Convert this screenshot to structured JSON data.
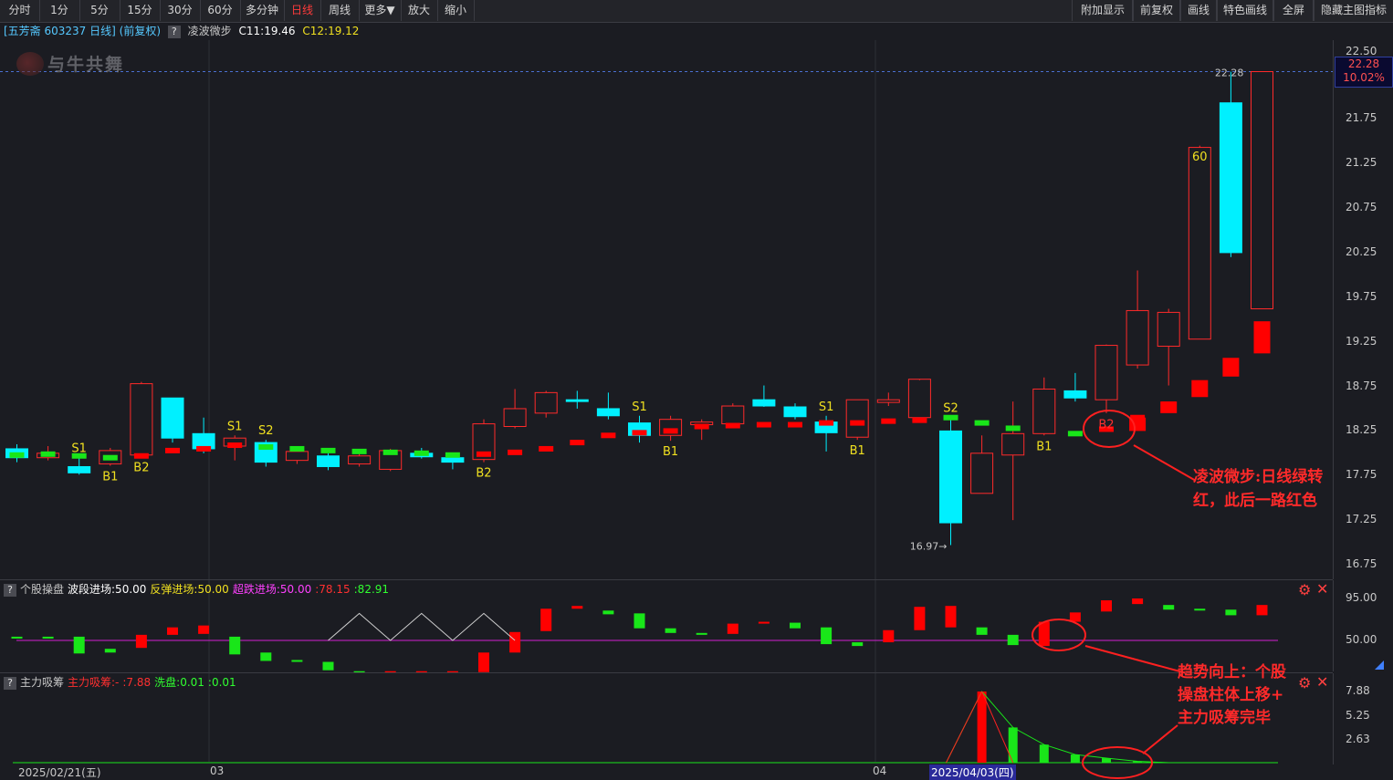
{
  "toolbar": {
    "left": [
      "分时",
      "1分",
      "5分",
      "15分",
      "30分",
      "60分",
      "多分钟",
      "日线",
      "周线",
      "更多▼",
      "放大",
      "缩小"
    ],
    "active": "日线",
    "right": [
      "附加显示",
      "前复权",
      "画线",
      "特色画线",
      "全屏",
      "隐藏主图指标"
    ]
  },
  "info": {
    "stock": "[五芳斋 603237 日线]",
    "adjust": "(前复权)",
    "q": "?",
    "indicator": "凌波微步",
    "c1": "C11:19.46",
    "c2": "C12:19.12"
  },
  "watermark": "与牛共舞",
  "main_axis": [
    "22.50",
    "21.75",
    "21.25",
    "20.75",
    "20.25",
    "19.75",
    "19.25",
    "18.75",
    "18.25",
    "17.75",
    "17.25",
    "16.75"
  ],
  "price_tag": {
    "price": "22.28",
    "pct": "10.02%"
  },
  "high_label": "22.28",
  "low_label": "16.97→",
  "signal_labels": {
    "b1": "B1",
    "b2": "B2",
    "s1": "S1",
    "s2": "S2",
    "sixty": "60"
  },
  "ind1": {
    "q": "?",
    "name": "个股操盘",
    "wave": "波段进场:50.00",
    "rebound": "反弹进场:50.00",
    "oversold": "超跌进场:50.00",
    "v1": ":78.15",
    "v2": ":82.91",
    "axis": [
      "95.00",
      "50.00"
    ]
  },
  "ind2": {
    "q": "?",
    "name": "主力吸筹",
    "absorb": "主力吸筹:-",
    "absorb_val": ":7.88",
    "wash": "洗盘:0.01",
    "v": ":0.01",
    "axis": [
      "7.88",
      "5.25",
      "2.63"
    ]
  },
  "dates": {
    "d1": "2025/02/21(五)",
    "d2": "03",
    "d3": "04",
    "d4": "2025/04/03(四)"
  },
  "annotations": {
    "a1_line1": "凌波微步:日线绿转",
    "a1_line2": "红，此后一路红色",
    "a2_line1": "趋势向上：个股",
    "a2_line2": "操盘柱体上移+",
    "a2_line3": "主力吸筹完毕"
  },
  "colors": {
    "up": "#ff2a2a",
    "down": "#00f0ff",
    "signal_green": "#19e619",
    "signal_red": "#ff0000",
    "ma_line": "#d020d0",
    "label_yellow": "#f0e020"
  },
  "chart_data": {
    "type": "candlestick",
    "ylim": [
      16.75,
      22.5
    ],
    "candles": [
      {
        "o": 18.05,
        "h": 18.1,
        "l": 17.9,
        "c": 17.95
      },
      {
        "o": 17.95,
        "h": 18.08,
        "l": 17.92,
        "c": 18.0
      },
      {
        "o": 17.85,
        "h": 17.95,
        "l": 17.76,
        "c": 17.78
      },
      {
        "o": 17.88,
        "h": 18.06,
        "l": 17.86,
        "c": 18.03
      },
      {
        "o": 17.98,
        "h": 18.8,
        "l": 17.96,
        "c": 18.78
      },
      {
        "o": 18.62,
        "h": 18.62,
        "l": 18.12,
        "c": 18.17
      },
      {
        "o": 18.22,
        "h": 18.4,
        "l": 18.0,
        "c": 18.05
      },
      {
        "o": 18.08,
        "h": 18.2,
        "l": 17.92,
        "c": 18.17
      },
      {
        "o": 18.12,
        "h": 18.15,
        "l": 17.85,
        "c": 17.9
      },
      {
        "o": 17.92,
        "h": 18.05,
        "l": 17.88,
        "c": 18.02
      },
      {
        "o": 17.97,
        "h": 18.0,
        "l": 17.81,
        "c": 17.85
      },
      {
        "o": 17.88,
        "h": 18.02,
        "l": 17.85,
        "c": 17.97
      },
      {
        "o": 17.82,
        "h": 18.05,
        "l": 17.8,
        "c": 18.03
      },
      {
        "o": 18.0,
        "h": 18.06,
        "l": 17.94,
        "c": 17.96
      },
      {
        "o": 17.95,
        "h": 18.0,
        "l": 17.82,
        "c": 17.9
      },
      {
        "o": 17.93,
        "h": 18.38,
        "l": 17.9,
        "c": 18.33
      },
      {
        "o": 18.3,
        "h": 18.72,
        "l": 18.28,
        "c": 18.5
      },
      {
        "o": 18.45,
        "h": 18.7,
        "l": 18.4,
        "c": 18.68
      },
      {
        "o": 18.6,
        "h": 18.7,
        "l": 18.5,
        "c": 18.58
      },
      {
        "o": 18.5,
        "h": 18.68,
        "l": 18.38,
        "c": 18.42
      },
      {
        "o": 18.34,
        "h": 18.42,
        "l": 18.12,
        "c": 18.2
      },
      {
        "o": 18.2,
        "h": 18.42,
        "l": 18.14,
        "c": 18.38
      },
      {
        "o": 18.32,
        "h": 18.38,
        "l": 18.15,
        "c": 18.35
      },
      {
        "o": 18.33,
        "h": 18.56,
        "l": 18.28,
        "c": 18.53
      },
      {
        "o": 18.6,
        "h": 18.76,
        "l": 18.52,
        "c": 18.53
      },
      {
        "o": 18.52,
        "h": 18.56,
        "l": 18.38,
        "c": 18.41
      },
      {
        "o": 18.35,
        "h": 18.42,
        "l": 18.02,
        "c": 18.23
      },
      {
        "o": 18.18,
        "h": 18.6,
        "l": 18.15,
        "c": 18.6
      },
      {
        "o": 18.57,
        "h": 18.68,
        "l": 18.53,
        "c": 18.6
      },
      {
        "o": 18.4,
        "h": 18.82,
        "l": 18.38,
        "c": 18.83
      },
      {
        "o": 18.25,
        "h": 18.4,
        "l": 16.97,
        "c": 17.22
      },
      {
        "o": 17.55,
        "h": 18.2,
        "l": 17.55,
        "c": 18.0
      },
      {
        "o": 17.98,
        "h": 18.58,
        "l": 17.25,
        "c": 18.22
      },
      {
        "o": 18.22,
        "h": 18.85,
        "l": 18.2,
        "c": 18.72
      },
      {
        "o": 18.7,
        "h": 18.9,
        "l": 18.58,
        "c": 18.62
      },
      {
        "o": 18.6,
        "h": 19.22,
        "l": 18.45,
        "c": 19.21
      },
      {
        "o": 18.99,
        "h": 20.05,
        "l": 18.95,
        "c": 19.6
      },
      {
        "o": 19.2,
        "h": 19.62,
        "l": 18.76,
        "c": 19.58
      },
      {
        "o": 19.28,
        "h": 21.45,
        "l": 19.28,
        "c": 21.43
      },
      {
        "o": 21.93,
        "h": 22.28,
        "l": 20.2,
        "c": 20.25
      },
      {
        "o": 19.62,
        "h": 22.28,
        "l": 19.62,
        "c": 22.28
      }
    ],
    "signal_bars": [
      {
        "i": 0,
        "v": 17.98,
        "c": "g"
      },
      {
        "i": 1,
        "v": 17.99,
        "c": "g"
      },
      {
        "i": 2,
        "v": 17.97,
        "c": "g"
      },
      {
        "i": 3,
        "v": 17.95,
        "c": "g"
      },
      {
        "i": 4,
        "v": 17.97,
        "c": "r"
      },
      {
        "i": 5,
        "v": 18.03,
        "c": "r"
      },
      {
        "i": 6,
        "v": 18.05,
        "c": "r"
      },
      {
        "i": 7,
        "v": 18.09,
        "c": "r"
      },
      {
        "i": 8,
        "v": 18.07,
        "c": "g"
      },
      {
        "i": 9,
        "v": 18.05,
        "c": "g"
      },
      {
        "i": 10,
        "v": 18.03,
        "c": "g"
      },
      {
        "i": 11,
        "v": 18.02,
        "c": "g"
      },
      {
        "i": 12,
        "v": 18.01,
        "c": "g"
      },
      {
        "i": 13,
        "v": 18.0,
        "c": "g"
      },
      {
        "i": 14,
        "v": 17.98,
        "c": "g"
      },
      {
        "i": 15,
        "v": 17.99,
        "c": "r"
      },
      {
        "i": 16,
        "v": 18.01,
        "c": "r"
      },
      {
        "i": 17,
        "v": 18.05,
        "c": "r"
      },
      {
        "i": 18,
        "v": 18.12,
        "c": "r"
      },
      {
        "i": 19,
        "v": 18.2,
        "c": "r"
      },
      {
        "i": 20,
        "v": 18.23,
        "c": "r"
      },
      {
        "i": 21,
        "v": 18.25,
        "c": "r"
      },
      {
        "i": 22,
        "v": 18.3,
        "c": "r"
      },
      {
        "i": 23,
        "v": 18.31,
        "c": "r"
      },
      {
        "i": 24,
        "v": 18.32,
        "c": "r"
      },
      {
        "i": 25,
        "v": 18.32,
        "c": "r"
      },
      {
        "i": 26,
        "v": 18.34,
        "c": "r"
      },
      {
        "i": 27,
        "v": 18.34,
        "c": "r"
      },
      {
        "i": 28,
        "v": 18.36,
        "c": "r"
      },
      {
        "i": 29,
        "v": 18.37,
        "c": "r"
      },
      {
        "i": 30,
        "v": 18.4,
        "c": "g"
      },
      {
        "i": 31,
        "v": 18.34,
        "c": "g"
      },
      {
        "i": 32,
        "v": 18.28,
        "c": "g"
      },
      {
        "i": 34,
        "v": 18.22,
        "c": "g"
      },
      {
        "i": 35,
        "v": 18.27,
        "c": "r"
      },
      {
        "i": 36,
        "v": 18.4,
        "c": "r"
      },
      {
        "i": 37,
        "v": 18.55,
        "c": "r"
      },
      {
        "i": 38,
        "v": 18.75,
        "c": "r"
      },
      {
        "i": 39,
        "v": 19.0,
        "c": "r"
      },
      {
        "i": 40,
        "v": 19.38,
        "c": "r"
      }
    ],
    "signals": [
      {
        "i": 2,
        "t": "S1",
        "pos": "above"
      },
      {
        "i": 3,
        "t": "B1",
        "pos": "below"
      },
      {
        "i": 4,
        "t": "B2",
        "pos": "below"
      },
      {
        "i": 7,
        "t": "S1",
        "pos": "above"
      },
      {
        "i": 8,
        "t": "S2",
        "pos": "above"
      },
      {
        "i": 15,
        "t": "B2",
        "pos": "below"
      },
      {
        "i": 20,
        "t": "S1",
        "pos": "above"
      },
      {
        "i": 21,
        "t": "B1",
        "pos": "below"
      },
      {
        "i": 26,
        "t": "S1",
        "pos": "above"
      },
      {
        "i": 27,
        "t": "B1",
        "pos": "below"
      },
      {
        "i": 30,
        "t": "S2",
        "pos": "above"
      },
      {
        "i": 33,
        "t": "B1",
        "pos": "below"
      },
      {
        "i": 35,
        "t": "B2",
        "pos": "red"
      }
    ],
    "ind1_bars": [
      {
        "i": 0,
        "top": 54,
        "bot": 52,
        "c": "g"
      },
      {
        "i": 1,
        "top": 54,
        "bot": 52,
        "c": "g"
      },
      {
        "i": 2,
        "top": 54,
        "bot": 36,
        "c": "g"
      },
      {
        "i": 3,
        "top": 41,
        "bot": 37,
        "c": "g"
      },
      {
        "i": 4,
        "top": 56,
        "bot": 42,
        "c": "r"
      },
      {
        "i": 5,
        "top": 64,
        "bot": 56,
        "c": "r"
      },
      {
        "i": 6,
        "top": 66,
        "bot": 57,
        "c": "r"
      },
      {
        "i": 7,
        "top": 54,
        "bot": 35,
        "c": "g"
      },
      {
        "i": 8,
        "top": 37,
        "bot": 28,
        "c": "g"
      },
      {
        "i": 9,
        "top": 29,
        "bot": 27,
        "c": "g"
      },
      {
        "i": 10,
        "top": 27,
        "bot": 18,
        "c": "g"
      },
      {
        "i": 11,
        "top": 17,
        "bot": 16,
        "c": "g"
      },
      {
        "i": 12,
        "top": 17,
        "bot": 16,
        "c": "r"
      },
      {
        "i": 13,
        "top": 17,
        "bot": 16,
        "c": "r"
      },
      {
        "i": 14,
        "top": 17,
        "bot": 16,
        "c": "r"
      },
      {
        "i": 15,
        "top": 37,
        "bot": 16,
        "c": "r"
      },
      {
        "i": 16,
        "top": 59,
        "bot": 37,
        "c": "r"
      },
      {
        "i": 17,
        "top": 84,
        "bot": 60,
        "c": "r"
      },
      {
        "i": 18,
        "top": 87,
        "bot": 84,
        "c": "r"
      },
      {
        "i": 19,
        "top": 82,
        "bot": 78,
        "c": "g"
      },
      {
        "i": 20,
        "top": 79,
        "bot": 63,
        "c": "g"
      },
      {
        "i": 21,
        "top": 63,
        "bot": 58,
        "c": "g"
      },
      {
        "i": 22,
        "top": 58,
        "bot": 56,
        "c": "g"
      },
      {
        "i": 23,
        "top": 68,
        "bot": 57,
        "c": "r"
      },
      {
        "i": 24,
        "top": 70,
        "bot": 68,
        "c": "r"
      },
      {
        "i": 25,
        "top": 69,
        "bot": 63,
        "c": "g"
      },
      {
        "i": 26,
        "top": 64,
        "bot": 46,
        "c": "g"
      },
      {
        "i": 27,
        "top": 48,
        "bot": 44,
        "c": "g"
      },
      {
        "i": 28,
        "top": 61,
        "bot": 48,
        "c": "r"
      },
      {
        "i": 29,
        "top": 86,
        "bot": 61,
        "c": "r"
      },
      {
        "i": 30,
        "top": 87,
        "bot": 64,
        "c": "r"
      },
      {
        "i": 31,
        "top": 64,
        "bot": 56,
        "c": "g"
      },
      {
        "i": 32,
        "top": 56,
        "bot": 45,
        "c": "g"
      },
      {
        "i": 33,
        "top": 70,
        "bot": 44,
        "c": "r"
      },
      {
        "i": 34,
        "top": 80,
        "bot": 70,
        "c": "r"
      },
      {
        "i": 35,
        "top": 93,
        "bot": 81,
        "c": "r"
      },
      {
        "i": 36,
        "top": 95,
        "bot": 89,
        "c": "r"
      },
      {
        "i": 37,
        "top": 88,
        "bot": 83,
        "c": "g"
      },
      {
        "i": 38,
        "top": 84,
        "bot": 83,
        "c": "g"
      },
      {
        "i": 39,
        "top": 83,
        "bot": 77,
        "c": "g"
      },
      {
        "i": 40,
        "top": 88,
        "bot": 77,
        "c": "r"
      }
    ],
    "ind1_zigzag": [
      [
        10,
        50
      ],
      [
        11,
        79
      ],
      [
        12,
        50
      ],
      [
        13,
        79
      ],
      [
        14,
        50
      ],
      [
        15,
        79
      ],
      [
        16,
        50
      ]
    ],
    "ind2_bars": [
      {
        "i": 31,
        "v": 7.88,
        "c": "r"
      },
      {
        "i": 32,
        "v": 3.9,
        "c": "g"
      },
      {
        "i": 33,
        "v": 2.0,
        "c": "g"
      },
      {
        "i": 34,
        "v": 0.9,
        "c": "g"
      },
      {
        "i": 35,
        "v": 0.5,
        "c": "g"
      },
      {
        "i": 36,
        "v": 0.15,
        "c": "g"
      }
    ],
    "ind2_ylim": [
      0,
      8.6
    ]
  }
}
